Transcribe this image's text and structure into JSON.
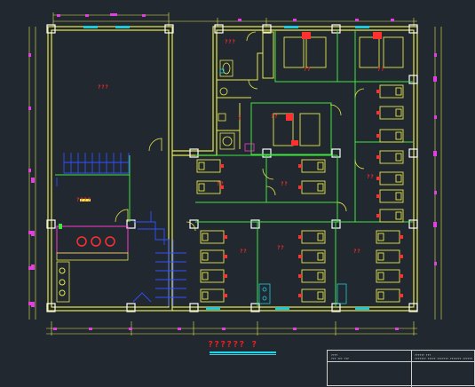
{
  "drawing": {
    "title": "??????    ?",
    "room_labels": {
      "top_left_hall": "???",
      "mid_left_room": "????",
      "toilet_area": "???",
      "toilet_small": "?",
      "top_room_1": "??",
      "top_room_2": "??",
      "mid_room_a": "??",
      "mid_room_b": "??",
      "lower_room_a": "??",
      "lower_room_b": "??",
      "lower_room_c": "??",
      "lower_room_d": "??",
      "lower_room_e": "??"
    },
    "title_block": {
      "r1c1": "????",
      "r1c2": "??????    ???",
      "r2c1": "??? ??? ???",
      "r2c2": "??????? ????? ??????? ??????? ??????"
    }
  }
}
